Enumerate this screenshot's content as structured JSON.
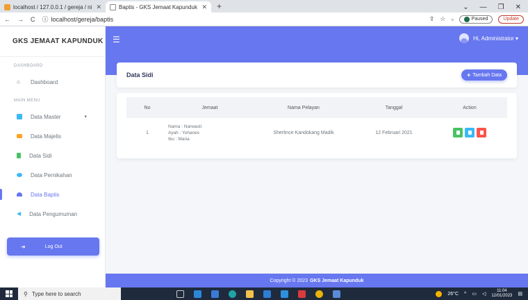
{
  "browser": {
    "tabs": [
      {
        "label": "localhost / 127.0.0.1 / gereja / ni",
        "active": false
      },
      {
        "label": "Baptis - GKS Jemaat Kapunduk",
        "active": true
      }
    ],
    "new_tab": "+",
    "url": "localhost/gereja/baptis",
    "paused_label": "Paused",
    "update_label": "Update"
  },
  "sidebar": {
    "brand": "GKS JEMAAT KAPUNDUK",
    "section_dashboard": "DASHBOARD",
    "dashboard_item": "Dashboard",
    "section_main": "MAIN MENU",
    "items": [
      {
        "label": "Data Master",
        "icon": "monitor-icon",
        "color": "#3abaf4"
      },
      {
        "label": "Data Majelis",
        "icon": "folder-icon",
        "color": "#ffa426"
      },
      {
        "label": "Data Sidi",
        "icon": "file-icon",
        "color": "#47c363"
      },
      {
        "label": "Data Pernikahan",
        "icon": "ring-icon",
        "color": "#3abaf4"
      },
      {
        "label": "Data Baptis",
        "icon": "users-icon",
        "color": "#6777ef"
      },
      {
        "label": "Data Pengumuman",
        "icon": "bullhorn-icon",
        "color": "#3abaf4"
      }
    ],
    "logout": "Log Out"
  },
  "navbar": {
    "user_label": "Hi, Administrator ▾"
  },
  "header_card": {
    "title": "Data Sidi",
    "add_button": "Tambah Data"
  },
  "table": {
    "headers": [
      "No",
      "Jemaat",
      "Nama Pelayan",
      "Tanggal",
      "Action"
    ],
    "rows": [
      {
        "no": "1",
        "nama": "Nama : Narwasti",
        "ayah": "Ayah : Yohanes",
        "ibu": "Ibu : Maria",
        "pelayan": "Sherlince Kandokang Madik",
        "tanggal": "12 Februari 2021"
      }
    ]
  },
  "footer": {
    "text": "Copyright © 2023",
    "brand": "GKS Jemaat Kapunduk"
  },
  "taskbar": {
    "search_placeholder": "Type here to search",
    "weather": "26°C",
    "time": "11:04",
    "date": "12/01/2023"
  },
  "colors": {
    "primary": "#6777ef",
    "success": "#47c363",
    "info": "#3abaf4",
    "danger": "#fc544b"
  }
}
